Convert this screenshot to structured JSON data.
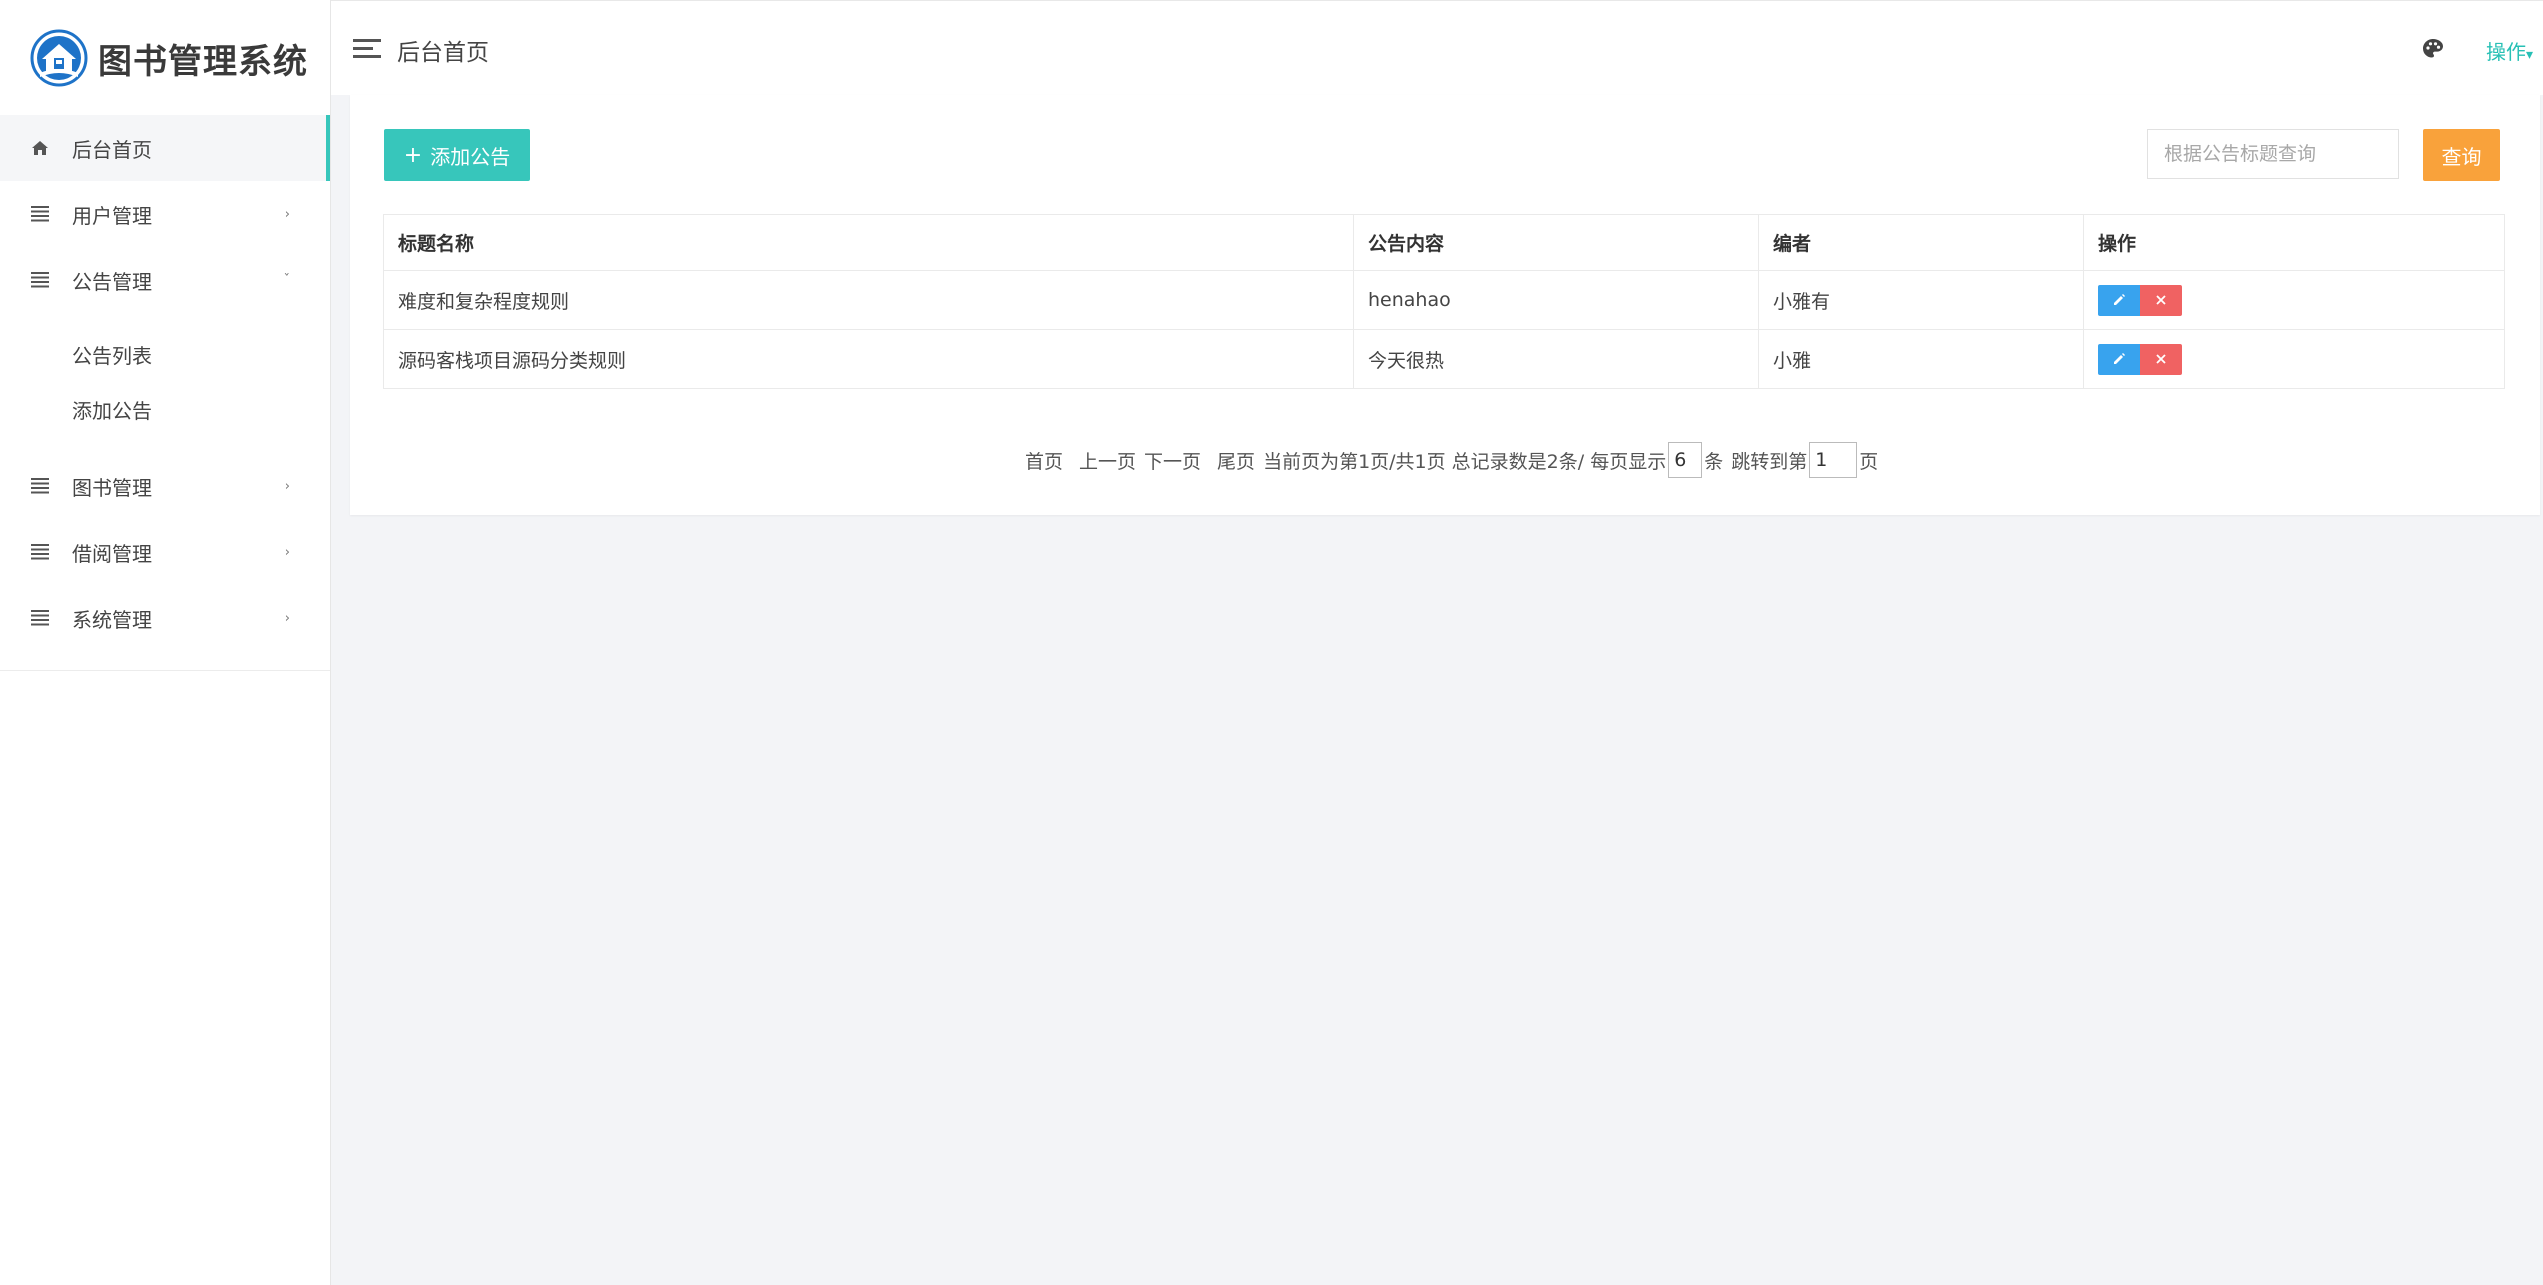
{
  "app": {
    "title": "图书管理系统"
  },
  "sidebar": {
    "items": [
      {
        "label": "后台首页",
        "icon": "home-icon",
        "active": true
      },
      {
        "label": "用户管理",
        "icon": "list-icon",
        "chevron": "›"
      },
      {
        "label": "公告管理",
        "icon": "list-icon",
        "chevron": "ˇ",
        "expanded": true,
        "children": [
          {
            "label": "公告列表"
          },
          {
            "label": "添加公告"
          }
        ]
      },
      {
        "label": "图书管理",
        "icon": "list-icon",
        "chevron": "›"
      },
      {
        "label": "借阅管理",
        "icon": "list-icon",
        "chevron": "›"
      },
      {
        "label": "系统管理",
        "icon": "list-icon",
        "chevron": "›"
      }
    ]
  },
  "topbar": {
    "title": "后台首页",
    "action_label": "操作",
    "action_caret": "▾"
  },
  "toolbar": {
    "add_label": "添加公告",
    "add_icon": "+",
    "search_placeholder": "根据公告标题查询",
    "search_label": "查询"
  },
  "table": {
    "headers": [
      "标题名称",
      "公告内容",
      "编者",
      "操作"
    ],
    "rows": [
      {
        "title": "难度和复杂程度规则",
        "content": "henahao",
        "author": "小雅有"
      },
      {
        "title": "源码客栈项目源码分类规则",
        "content": "今天很热",
        "author": "小雅"
      }
    ]
  },
  "pagination": {
    "first": "首页",
    "prev": "上一页",
    "next": "下一页",
    "last": "尾页",
    "status": "当前页为第1页/共1页 总记录数是2条/ 每页显示",
    "page_size": "6",
    "unit": "条",
    "jump_prefix": "跳转到第",
    "jump_value": "1",
    "jump_suffix": "页"
  },
  "colors": {
    "accent": "#37c6bb",
    "search_button": "#f9a23b",
    "edit_button": "#38a3ee",
    "delete_button": "#f06262",
    "logo_blue": "#1e73c8"
  }
}
